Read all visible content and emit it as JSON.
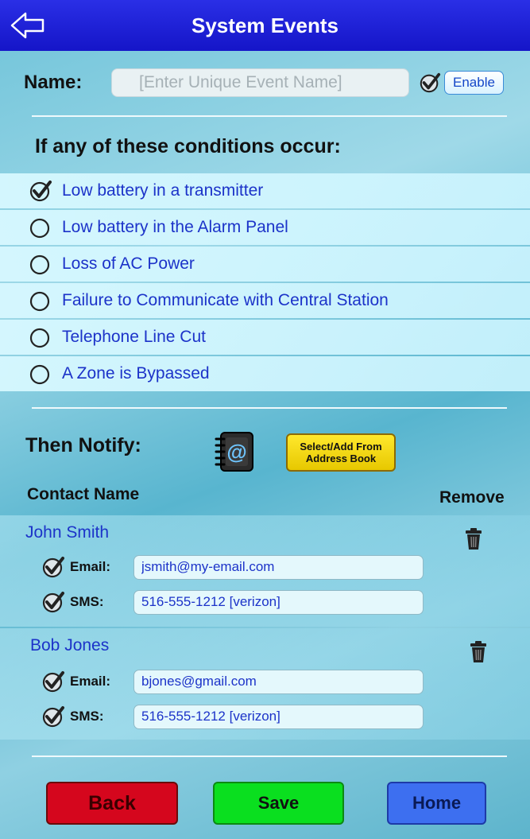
{
  "header": {
    "title": "System Events"
  },
  "name_row": {
    "label": "Name:",
    "placeholder": "[Enter Unique Event Name]",
    "value": "",
    "enabled_checked": true,
    "enable_label": "Enable"
  },
  "conditions": {
    "heading": "If any of these conditions occur:",
    "items": [
      {
        "label": "Low battery in a transmitter",
        "checked": true
      },
      {
        "label": "Low battery in the Alarm Panel",
        "checked": false
      },
      {
        "label": "Loss of AC Power",
        "checked": false
      },
      {
        "label": "Failure to Communicate with Central Station",
        "checked": false
      },
      {
        "label": "Telephone Line Cut",
        "checked": false
      },
      {
        "label": "A Zone is Bypassed",
        "checked": false
      }
    ]
  },
  "notify": {
    "label": "Then Notify:",
    "address_book_button": "Select/Add From Address Book",
    "col_contact": "Contact Name",
    "col_remove": "Remove",
    "contacts": [
      {
        "name": "John Smith",
        "email_label": "Email:",
        "email": "jsmith@my-email.com",
        "email_checked": true,
        "sms_label": "SMS:",
        "sms": "516-555-1212 [verizon]",
        "sms_checked": true
      },
      {
        "name": "Bob Jones",
        "email_label": "Email:",
        "email": "bjones@gmail.com",
        "email_checked": true,
        "sms_label": "SMS:",
        "sms": "516-555-1212 [verizon]",
        "sms_checked": true
      }
    ]
  },
  "footer": {
    "back": "Back",
    "save": "Save",
    "home": "Home"
  }
}
